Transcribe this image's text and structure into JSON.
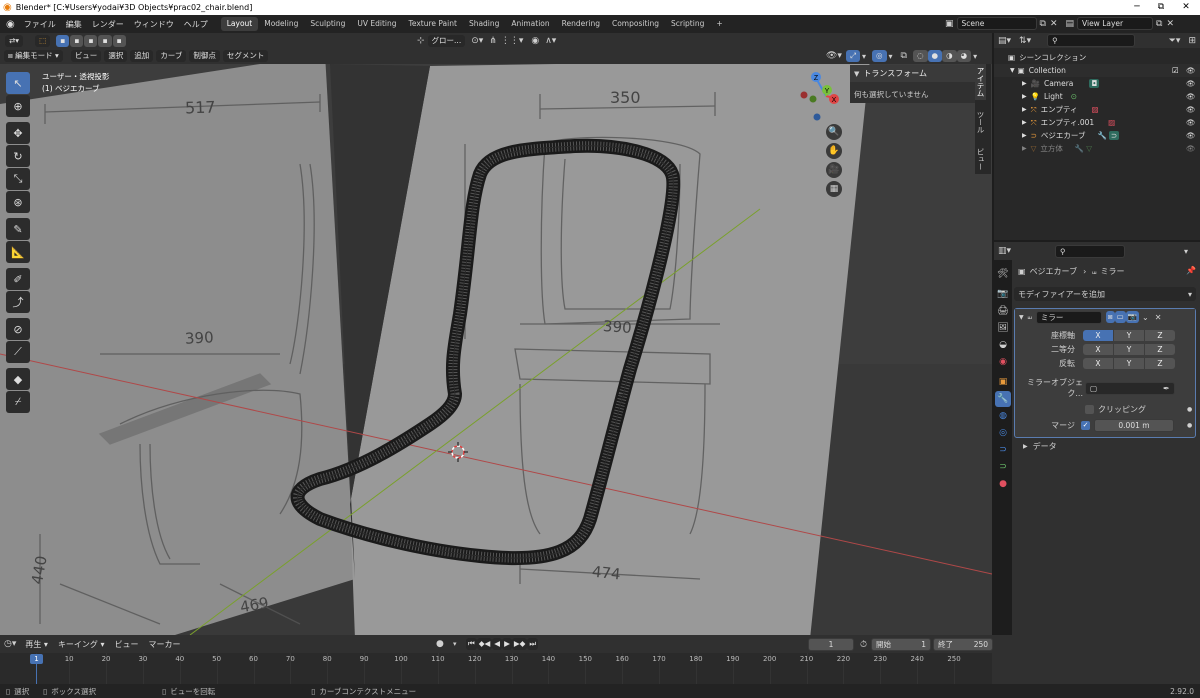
{
  "window": {
    "title": "Blender* [C:¥Users¥yodai¥3D Objects¥prac02_chair.blend]",
    "minimize": "─",
    "maximize": "⧉",
    "close": "✕"
  },
  "menu": {
    "items": [
      "ファイル",
      "編集",
      "レンダー",
      "ウィンドウ",
      "ヘルプ"
    ]
  },
  "workspaces": [
    "Layout",
    "Modeling",
    "Sculpting",
    "UV Editing",
    "Texture Paint",
    "Shading",
    "Animation",
    "Rendering",
    "Compositing",
    "Scripting"
  ],
  "add_workspace": "+",
  "scene": {
    "name": "Scene",
    "view_layer": "View Layer"
  },
  "viewport_header": {
    "transform_orientation": "グロー...",
    "mode": "編集モード",
    "menus": [
      "ビュー",
      "選択",
      "追加",
      "カーブ",
      "制御点",
      "セグメント"
    ]
  },
  "viewport": {
    "view_name": "ユーザー・透視投影",
    "object_name": "(1) ベジエカーブ",
    "annotations": [
      "517",
      "390",
      "440",
      "469",
      "350",
      "390",
      "474"
    ]
  },
  "gizmo": {
    "x": "X",
    "y": "Y",
    "z": "Z"
  },
  "npanel": {
    "section": "トランスフォーム",
    "message": "何も選択していません",
    "tabs": [
      "アイテム",
      "ツール",
      "ビュー"
    ]
  },
  "outliner": {
    "root": "シーンコレクション",
    "collection": "Collection",
    "items": [
      {
        "name": "Camera",
        "icon": "camera-icon",
        "color": "#e89a3c"
      },
      {
        "name": "Light",
        "icon": "light-icon",
        "color": "#e89a3c"
      },
      {
        "name": "エンプティ",
        "icon": "empty-icon",
        "color": "#e89a3c"
      },
      {
        "name": "エンプティ.001",
        "icon": "empty-icon",
        "color": "#e89a3c"
      },
      {
        "name": "ベジエカーブ",
        "icon": "curve-icon",
        "color": "#e89a3c"
      },
      {
        "name": "立方体",
        "icon": "mesh-icon",
        "color": "#e89a3c"
      }
    ]
  },
  "properties": {
    "breadcrumb_object": "ベジエカーブ",
    "breadcrumb_modifier": "ミラー",
    "add_modifier": "モディファイアーを追加",
    "modifier_name": "ミラー",
    "axis_label": "座標軸",
    "bisect_label": "二等分",
    "flip_label": "反転",
    "axes": [
      "X",
      "Y",
      "Z"
    ],
    "mirror_object_label": "ミラーオブジェク...",
    "clipping_label": "クリッピング",
    "merge_label": "マージ",
    "merge_value": "0.001 m",
    "data_label": "データ"
  },
  "timeline": {
    "menus": [
      "再生",
      "キーイング",
      "ビュー",
      "マーカー"
    ],
    "current_frame": "1",
    "start_label": "開始",
    "start": "1",
    "end_label": "終了",
    "end": "250",
    "ticks": [
      "1",
      "10",
      "20",
      "30",
      "40",
      "50",
      "60",
      "70",
      "80",
      "90",
      "100",
      "110",
      "120",
      "130",
      "140",
      "150",
      "160",
      "170",
      "180",
      "190",
      "200",
      "210",
      "220",
      "230",
      "240",
      "250"
    ]
  },
  "status": {
    "select": "選択",
    "box_select": "ボックス選択",
    "rotate_view": "ビューを回転",
    "context_menu": "カーブコンテクストメニュー",
    "version": "2.92.0"
  }
}
